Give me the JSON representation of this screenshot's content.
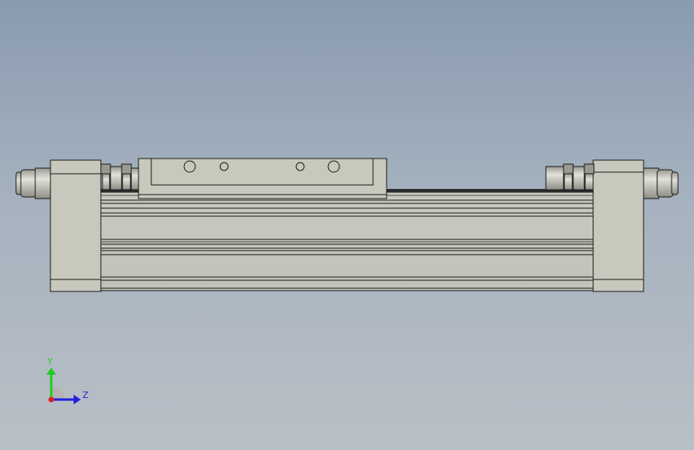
{
  "viewport": {
    "background_top": "#8a9bb0",
    "background_bottom": "#b9bfc6"
  },
  "model": {
    "part_color": "#c8c8bd",
    "edge_color": "#1a1a1a"
  },
  "triad": {
    "y_label": "Y",
    "z_label": "Z",
    "y_color": "#22cc22",
    "z_color": "#2222dd",
    "origin_color": "#dd2222"
  }
}
